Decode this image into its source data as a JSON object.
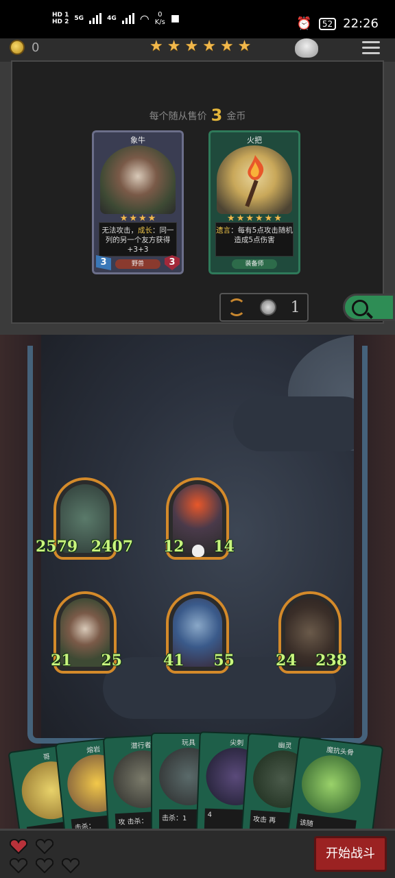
{
  "status_bar": {
    "hd1": "HD 1",
    "hd2": "HD 2",
    "net_5g": "5G",
    "net_4g": "4G",
    "speed_value": "0",
    "speed_unit": "K/s",
    "battery": "52",
    "time": "22:26"
  },
  "shop": {
    "coins": "0",
    "stars": [
      "★",
      "★",
      "★",
      "★",
      "★",
      "★"
    ],
    "price_prefix": "每个随从售价",
    "price_value": "3",
    "price_suffix": "金币",
    "cards": [
      {
        "title": "象牛",
        "stars": [
          "★",
          "★",
          "★",
          "★"
        ],
        "desc_1": "无法攻击，",
        "desc_hl": "成长",
        "desc_2": "：同一列的另一个友方获得+3+3",
        "tag": "野兽",
        "atk": "3",
        "hp": "3"
      },
      {
        "title": "火把",
        "stars": [
          "★",
          "★",
          "★",
          "★",
          "★",
          "★"
        ],
        "desc_hl": "遗言",
        "desc_2": "：每有5点攻击随机造成5点伤害",
        "tag": "装备师"
      }
    ],
    "refresh_cost": "1"
  },
  "board": {
    "minions": [
      {
        "atk": "2579",
        "hp": "2407"
      },
      {
        "atk": "12",
        "hp": "14"
      },
      {
        "atk": "21",
        "hp": "25"
      },
      {
        "atk": "41",
        "hp": "55"
      },
      {
        "atk": "24",
        "hp": "238"
      }
    ]
  },
  "hand": [
    {
      "title": "哥",
      "desc": "言："
    },
    {
      "title": "熔岩",
      "desc": "击杀："
    },
    {
      "title": "潜行者",
      "desc": "攻 击杀："
    },
    {
      "title": "玩具",
      "desc": "击杀：1"
    },
    {
      "title": "尖刺",
      "desc": "4"
    },
    {
      "title": "幽灵",
      "desc": "攻击 再"
    },
    {
      "title": "魔抗头骨",
      "desc": "该随"
    }
  ],
  "bottom": {
    "start_button": "开始战斗"
  },
  "colors": {
    "accent_gold": "#e3b53a",
    "card_green": "#2e8d55",
    "start_red": "#9b2222",
    "stat_green": "#c9f57e"
  }
}
